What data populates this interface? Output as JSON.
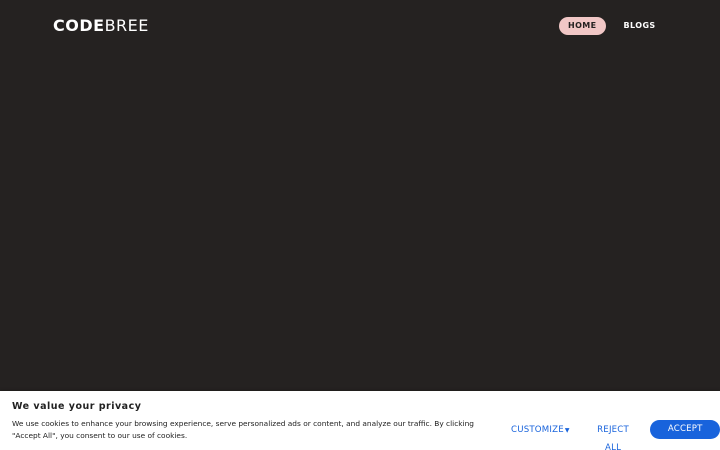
{
  "header": {
    "logo_bold": "CODE",
    "logo_light": "BREE",
    "nav": [
      {
        "label": "HOME",
        "active": true
      },
      {
        "label": "BLOGS",
        "active": false
      }
    ]
  },
  "cookie_banner": {
    "title": "We value your privacy",
    "text": "We use cookies to enhance your browsing experience, serve personalized ads or content, and analyze our traffic. By clicking \"Accept All\", you consent to our use of cookies.",
    "customize_label": "CUSTOMIZE",
    "reject_label": "REJECT ALL",
    "accept_label": "ACCEPT ALL"
  },
  "colors": {
    "background": "#252221",
    "nav_active_bg": "#f1c7c6",
    "accent": "#1863dc"
  }
}
